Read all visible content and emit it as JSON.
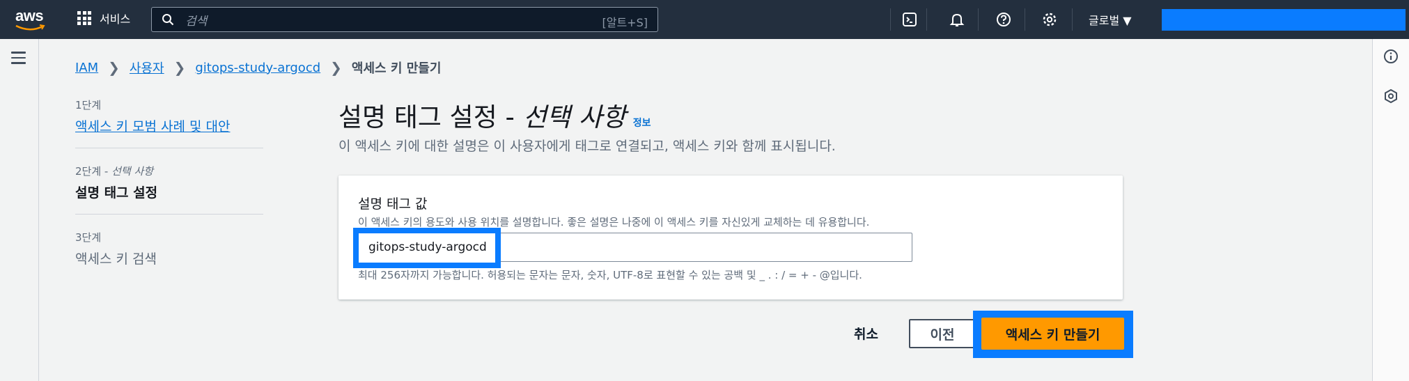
{
  "topnav": {
    "logo": "aws",
    "services_label": "서비스",
    "search_placeholder": "검색",
    "search_shortcut": "[알트+S]",
    "region_label": "글로벌 ▼",
    "icons": [
      "cloudshell-icon",
      "notifications-icon",
      "help-icon",
      "settings-icon"
    ],
    "account_bar_color": "#0a7cff"
  },
  "breadcrumb": {
    "items": [
      "IAM",
      "사용자",
      "gitops-study-argocd"
    ],
    "current": "액세스 키 만들기"
  },
  "steps": [
    {
      "num": "1단계",
      "label": "액세스 키 모범 사례 및 대안",
      "state": "link"
    },
    {
      "num": "2단계 - ",
      "num_optional": "선택 사항",
      "label": "설명 태그 설정",
      "state": "current"
    },
    {
      "num": "3단계",
      "label": "액세스 키 검색",
      "state": "disabled"
    }
  ],
  "main": {
    "title": "설명 태그 설정 -",
    "title_optional": "선택 사항",
    "info_link": "정보",
    "description": "이 액세스 키에 대한 설명은 이 사용자에게 태그로 연결되고, 액세스 키와 함께 표시됩니다."
  },
  "field": {
    "label": "설명 태그 값",
    "description": "이 액세스 키의 용도와 사용 위치를 설명합니다. 좋은 설명은 나중에 이 액세스 키를 자신있게 교체하는 데 유용합니다.",
    "value": "gitops-study-argocd",
    "constraint": "최대 256자까지 가능합니다. 허용되는 문자는 문자, 숫자, UTF-8로 표현할 수 있는 공백 및 _ . : / = + - @입니다."
  },
  "actions": {
    "cancel": "취소",
    "previous": "이전",
    "create": "액세스 키 만들기"
  },
  "colors": {
    "primary_button": "#ff9900",
    "highlight": "#0a7cff",
    "link": "#0972d3",
    "topnav": "#232f3e"
  }
}
